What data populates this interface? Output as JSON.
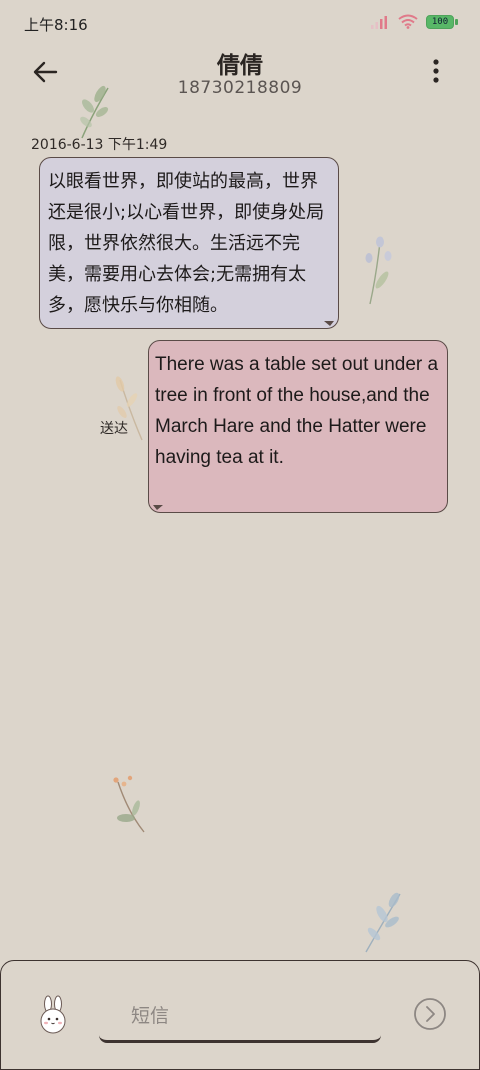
{
  "status_bar": {
    "time": "上午8:16",
    "battery": "100",
    "icons": [
      "signal-icon",
      "wifi-icon",
      "battery-icon"
    ]
  },
  "header": {
    "contact_name": "倩倩",
    "contact_number": "18730218809",
    "icons": [
      "back-arrow-icon",
      "more-vertical-icon"
    ]
  },
  "conversation": {
    "timestamp": "2016-6-13 下午1:49",
    "messages": [
      {
        "direction": "incoming",
        "text": "以眼看世界，即使站的最高，世界还是很小;以心看世界，即使身处局限，世界依然很大。生活远不完美，需要用心去体会;无需拥有太多，愿快乐与你相随。"
      },
      {
        "direction": "outgoing",
        "text": "There was a table set out under a tree in front of the house,and the March Hare and the Hatter were having tea at it.",
        "status": "送达"
      }
    ]
  },
  "composer": {
    "placeholder": "短信",
    "icons": [
      "rabbit-avatar-icon",
      "send-arrow-icon"
    ]
  },
  "colors": {
    "background": "#dcd5cb",
    "incoming_bubble": "#d4d0dc",
    "outgoing_bubble": "#dbb8bd",
    "border": "#5a4b47"
  }
}
